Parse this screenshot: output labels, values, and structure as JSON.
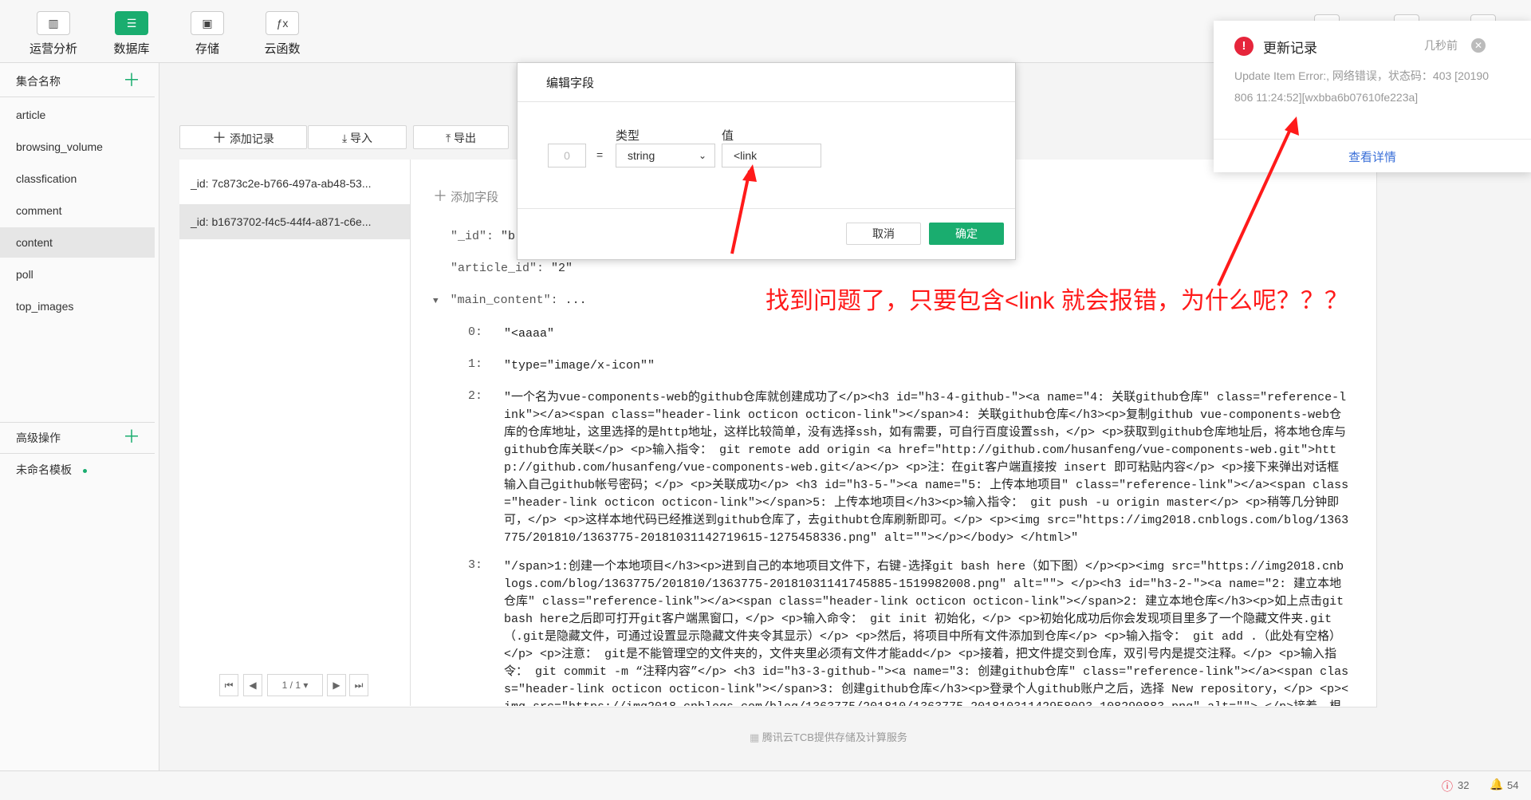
{
  "toolbar": {
    "items": [
      {
        "label": "运营分析",
        "icon": "bar-chart-icon"
      },
      {
        "label": "数据库",
        "icon": "database-icon"
      },
      {
        "label": "存储",
        "icon": "save-icon"
      },
      {
        "label": "云函数",
        "icon": "function-icon"
      }
    ]
  },
  "sidebar": {
    "collections_header": "集合名称",
    "collections": [
      "article",
      "browsing_volume",
      "classfication",
      "comment",
      "content",
      "poll",
      "top_images"
    ],
    "advanced_header": "高级操作",
    "templates": [
      "未命名模板"
    ]
  },
  "actions": {
    "add_record": "添加记录",
    "import": "导入",
    "export": "导出"
  },
  "docs": [
    "_id: 7c873c2e-b766-497a-ab48-53...",
    "_id: b1673702-f4c5-44f4-a871-c6e..."
  ],
  "pager": {
    "page": "1 / 1"
  },
  "detail": {
    "add_field": "添加字段",
    "id_key": "\"_id\":",
    "id_val_partial": "\"b",
    "article_key": "\"article_id\":",
    "article_val": "\"2\"",
    "main_key": "\"main_content\":",
    "main_val": "...",
    "items": [
      {
        "idx": "0:",
        "val": "\"<aaaa\""
      },
      {
        "idx": "1:",
        "val": "\"type=\"image/x-icon\"\""
      },
      {
        "idx": "2:",
        "val": "\"一个名为vue-components-web的github仓库就创建成功了</p><h3 id=\"h3-4-github-\"><a name=\"4: 关联github仓库\" class=\"reference-link\"></a><span class=\"header-link octicon octicon-link\"></span>4: 关联github仓库</h3><p>复制github vue-components-web仓库的仓库地址，这里选择的是http地址，这样比较简单，没有选择ssh，如有需要，可自行百度设置ssh，</p> <p>获取到github仓库地址后，将本地仓库与github仓库关联</p> <p>输入指令： git remote add origin <a href=\"http://github.com/husanfeng/vue-components-web.git\">http://github.com/husanfeng/vue-components-web.git</a></p> <p>注：在git客户端直接按 insert 即可粘贴内容</p> <p>接下来弹出对话框输入自己github帐号密码；</p> <p>关联成功</p> <h3 id=\"h3-5-\"><a name=\"5: 上传本地项目\" class=\"reference-link\"></a><span class=\"header-link octicon octicon-link\"></span>5: 上传本地项目</h3><p>输入指令： git push -u origin master</p> <p>稍等几分钟即可，</p> <p>这样本地代码已经推送到github仓库了，去githubt仓库刷新即可。</p> <p><img src=\"https://img2018.cnblogs.com/blog/1363775/201810/1363775-20181031142719615-1275458336.png\" alt=\"\"></p></body> </html>\""
      },
      {
        "idx": "3:",
        "val": "\"/span>1:创建一个本地项目</h3><p>进到自己的本地项目文件下，右键-选择git bash here（如下图）</p><p><img src=\"https://img2018.cnblogs.com/blog/1363775/201810/1363775-20181031141745885-1519982008.png\" alt=\"\"> </p><h3 id=\"h3-2-\"><a name=\"2: 建立本地仓库\" class=\"reference-link\"></a><span class=\"header-link octicon octicon-link\"></span>2: 建立本地仓库</h3><p>如上点击git bash here之后即可打开git客户端黑窗口，</p> <p>输入命令： git init 初始化，</p> <p>初始化成功后你会发现项目里多了一个隐藏文件夹.git（.git是隐藏文件，可通过设置显示隐藏文件夹令其显示）</p> <p>然后，将项目中所有文件添加到仓库</p> <p>输入指令： git add .（此处有空格）</p> <p>注意： git是不能管理空的文件夹的，文件夹里必须有文件才能add</p> <p>接着，把文件提交到仓库，双引号内是提交注释。</p> <p>输入指令： git commit -m “注释内容”</p> <h3 id=\"h3-3-github-\"><a name=\"3: 创建github仓库\" class=\"reference-link\"></a><span class=\"header-link octicon octicon-link\"></span>3: 创建github仓库</h3><p>登录个人github账户之后，选择 New repository，</p> <p><img src=\"https://img2018.cnblogs.com/blog/1363775/201810/1363775-20181031142958093-108290883.png\" alt=\"\"> </p>接着，根据提示创建一"
      }
    ]
  },
  "footer": {
    "text": "腾讯云TCB提供存储及计算服务"
  },
  "status": {
    "errors": "32",
    "notices": "54"
  },
  "modal": {
    "title": "编辑字段",
    "type_label": "类型",
    "value_label": "值",
    "index_value": "0",
    "equals": "=",
    "type_value": "string",
    "field_value": "<link",
    "cancel": "取消",
    "confirm": "确定"
  },
  "notification": {
    "title": "更新记录",
    "time": "几秒前",
    "message": "Update Item Error:, 网络错误，状态码：403 [20190806 11:24:52][wxbba6b07610fe223a]",
    "details": "查看详情"
  },
  "annotation": {
    "text": "找到问题了，只要包含<link 就会报错，为什么呢？？？"
  },
  "colors": {
    "accent": "#1aad6f",
    "error": "#e6253b",
    "annotation": "#ff1a1a"
  }
}
